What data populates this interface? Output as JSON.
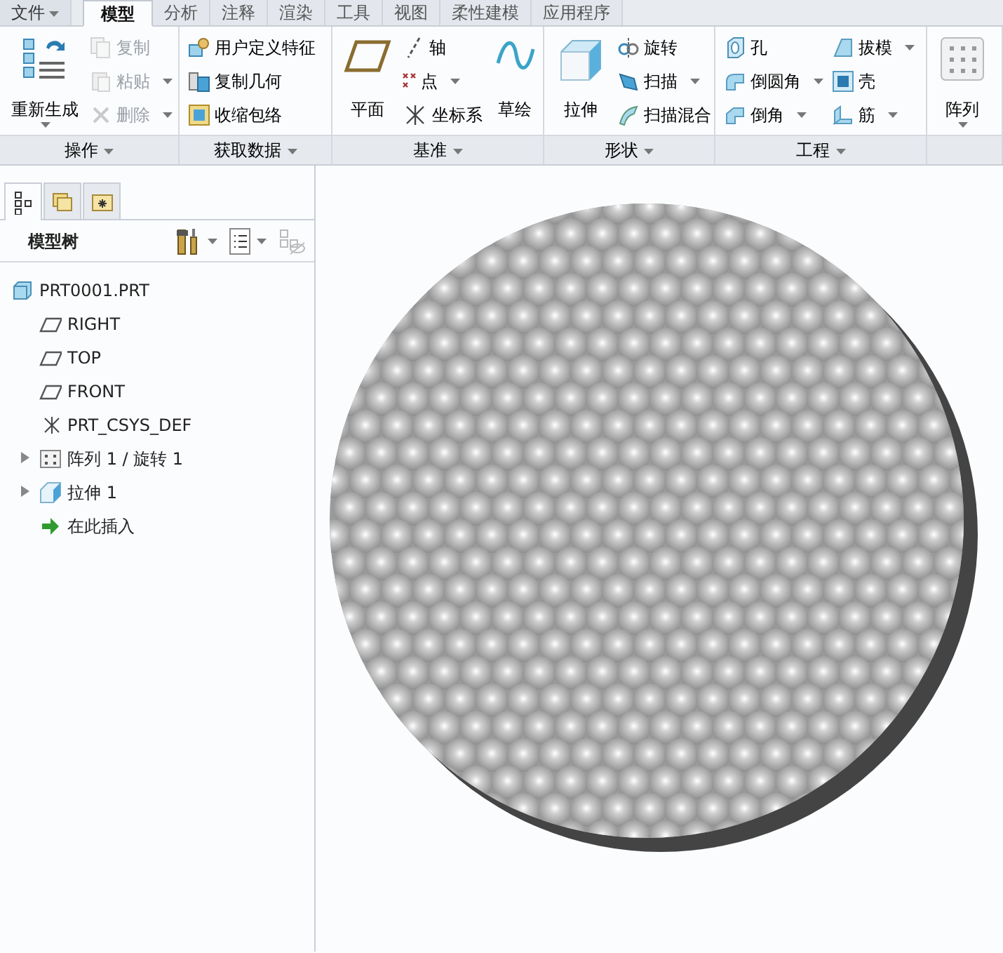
{
  "menu_tabs": [
    {
      "label": "文件",
      "kind": "file",
      "selected": false
    },
    {
      "label": "模型",
      "kind": "tab",
      "selected": true
    },
    {
      "label": "分析",
      "kind": "tab",
      "selected": false
    },
    {
      "label": "注释",
      "kind": "tab",
      "selected": false
    },
    {
      "label": "渲染",
      "kind": "tab",
      "selected": false
    },
    {
      "label": "工具",
      "kind": "tab",
      "selected": false
    },
    {
      "label": "视图",
      "kind": "tab",
      "selected": false
    },
    {
      "label": "柔性建模",
      "kind": "tab",
      "selected": false
    },
    {
      "label": "应用程序",
      "kind": "tab",
      "selected": false
    }
  ],
  "ribbon_groups": [
    {
      "label": "操作",
      "columns": [
        {
          "kind": "large",
          "items": [
            {
              "label": "重新生成",
              "disabled": false,
              "dropdown": true
            }
          ]
        },
        {
          "kind": "small",
          "items": [
            {
              "label": "复制",
              "disabled": true,
              "dropdown": false
            },
            {
              "label": "粘贴",
              "disabled": true,
              "dropdown": true
            },
            {
              "label": "删除",
              "disabled": true,
              "dropdown": true
            }
          ]
        }
      ]
    },
    {
      "label": "获取数据",
      "columns": [
        {
          "kind": "small",
          "items": [
            {
              "label": "用户定义特征",
              "disabled": false,
              "dropdown": false
            },
            {
              "label": "复制几何",
              "disabled": false,
              "dropdown": false
            },
            {
              "label": "收缩包络",
              "disabled": false,
              "dropdown": false
            }
          ]
        }
      ]
    },
    {
      "label": "基准",
      "columns": [
        {
          "kind": "large",
          "items": [
            {
              "label": "平面",
              "disabled": false,
              "dropdown": false
            }
          ]
        },
        {
          "kind": "small",
          "items": [
            {
              "label": "轴",
              "disabled": false,
              "dropdown": false
            },
            {
              "label": "点",
              "disabled": false,
              "dropdown": true
            },
            {
              "label": "坐标系",
              "disabled": false,
              "dropdown": false
            }
          ]
        },
        {
          "kind": "large",
          "items": [
            {
              "label": "草绘",
              "disabled": false,
              "dropdown": false
            }
          ]
        }
      ]
    },
    {
      "label": "形状",
      "columns": [
        {
          "kind": "large",
          "items": [
            {
              "label": "拉伸",
              "disabled": false,
              "dropdown": false
            }
          ]
        },
        {
          "kind": "small",
          "items": [
            {
              "label": "旋转",
              "disabled": false,
              "dropdown": false
            },
            {
              "label": "扫描",
              "disabled": false,
              "dropdown": true
            },
            {
              "label": "扫描混合",
              "disabled": false,
              "dropdown": false
            }
          ]
        }
      ]
    },
    {
      "label": "工程",
      "columns": [
        {
          "kind": "small",
          "items": [
            {
              "label": "孔",
              "disabled": false,
              "dropdown": false
            },
            {
              "label": "倒圆角",
              "disabled": false,
              "dropdown": true
            },
            {
              "label": "倒角",
              "disabled": false,
              "dropdown": true
            }
          ]
        },
        {
          "kind": "small",
          "items": [
            {
              "label": "拔模",
              "disabled": false,
              "dropdown": true
            },
            {
              "label": "壳",
              "disabled": false,
              "dropdown": false
            },
            {
              "label": "筋",
              "disabled": false,
              "dropdown": true
            }
          ]
        }
      ]
    },
    {
      "columns": [
        {
          "kind": "large",
          "items": [
            {
              "label": "阵列",
              "disabled": false,
              "dropdown": true
            }
          ]
        }
      ]
    }
  ],
  "panel_tabs": [
    {
      "selected": true
    },
    {
      "selected": false
    },
    {
      "selected": false
    }
  ],
  "model_tree": {
    "title": "模型树",
    "root": {
      "label": "PRT0001.PRT",
      "children": [
        {
          "label": "RIGHT",
          "kind": "plane"
        },
        {
          "label": "TOP",
          "kind": "plane"
        },
        {
          "label": "FRONT",
          "kind": "plane"
        },
        {
          "label": "PRT_CSYS_DEF",
          "kind": "csys"
        },
        {
          "label": "阵列 1 / 旋转 1",
          "kind": "pattern",
          "expanded": false
        },
        {
          "label": "拉伸 1",
          "kind": "extrude",
          "expanded": false
        },
        {
          "label": "在此插入",
          "kind": "insert"
        }
      ]
    }
  }
}
